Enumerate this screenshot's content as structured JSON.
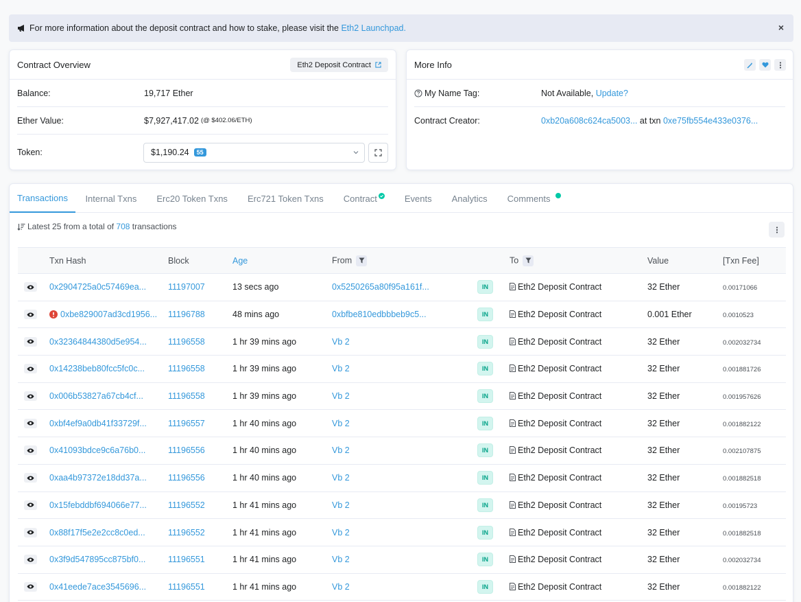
{
  "alert": {
    "text": "For more information about the deposit contract and how to stake, please visit the",
    "link": "Eth2 Launchpad.",
    "close": "×"
  },
  "overview": {
    "title": "Contract Overview",
    "chip": "Eth2 Deposit Contract",
    "balance_label": "Balance:",
    "balance_value": "19,717 Ether",
    "ether_value_label": "Ether Value:",
    "ether_value": "$7,927,417.02",
    "ether_price": "(@ $402.06/ETH)",
    "token_label": "Token:",
    "token_value": "$1,190.24",
    "token_count": "55"
  },
  "more_info": {
    "title": "More Info",
    "name_tag_label": "My Name Tag:",
    "name_tag_value": "Not Available,",
    "name_tag_link": "Update?",
    "creator_label": "Contract Creator:",
    "creator_address": "0xb20a608c624ca5003...",
    "creator_at": "at txn",
    "creator_txn": "0xe75fb554e433e0376..."
  },
  "tabs": [
    {
      "label": "Transactions",
      "active": true
    },
    {
      "label": "Internal Txns"
    },
    {
      "label": "Erc20 Token Txns"
    },
    {
      "label": "Erc721 Token Txns"
    },
    {
      "label": "Contract"
    },
    {
      "label": "Events"
    },
    {
      "label": "Analytics"
    },
    {
      "label": "Comments"
    }
  ],
  "summary": {
    "prefix": "Latest 25 from a total of",
    "count": "708",
    "suffix": "transactions"
  },
  "table": {
    "headers": [
      "Txn Hash",
      "Block",
      "Age",
      "From",
      "To",
      "Value",
      "[Txn Fee]"
    ],
    "rows": [
      {
        "hash": "0x2904725a0c57469ea...",
        "block": "11197007",
        "age": "13 secs ago",
        "from": "0x5250265a80f95a161f...",
        "dir": "IN",
        "to": "Eth2 Deposit Contract",
        "value": "32 Ether",
        "fee": "0.00171066",
        "error": false
      },
      {
        "hash": "0xbe829007ad3cd1956...",
        "block": "11196788",
        "age": "48 mins ago",
        "from": "0xbfbe810edbbbeb9c5...",
        "dir": "IN",
        "to": "Eth2 Deposit Contract",
        "value": "0.001 Ether",
        "fee": "0.0010523",
        "error": true
      },
      {
        "hash": "0x32364844380d5e954...",
        "block": "11196558",
        "age": "1 hr 39 mins ago",
        "from": "Vb 2",
        "dir": "IN",
        "to": "Eth2 Deposit Contract",
        "value": "32 Ether",
        "fee": "0.002032734",
        "error": false
      },
      {
        "hash": "0x14238beb80fcc5fc0c...",
        "block": "11196558",
        "age": "1 hr 39 mins ago",
        "from": "Vb 2",
        "dir": "IN",
        "to": "Eth2 Deposit Contract",
        "value": "32 Ether",
        "fee": "0.001881726",
        "error": false
      },
      {
        "hash": "0x006b53827a67cb4cf...",
        "block": "11196558",
        "age": "1 hr 39 mins ago",
        "from": "Vb 2",
        "dir": "IN",
        "to": "Eth2 Deposit Contract",
        "value": "32 Ether",
        "fee": "0.001957626",
        "error": false
      },
      {
        "hash": "0xbf4ef9a0db41f33729f...",
        "block": "11196557",
        "age": "1 hr 40 mins ago",
        "from": "Vb 2",
        "dir": "IN",
        "to": "Eth2 Deposit Contract",
        "value": "32 Ether",
        "fee": "0.001882122",
        "error": false
      },
      {
        "hash": "0x41093bdce9c6a76b0...",
        "block": "11196556",
        "age": "1 hr 40 mins ago",
        "from": "Vb 2",
        "dir": "IN",
        "to": "Eth2 Deposit Contract",
        "value": "32 Ether",
        "fee": "0.002107875",
        "error": false
      },
      {
        "hash": "0xaa4b97372e18dd37a...",
        "block": "11196556",
        "age": "1 hr 40 mins ago",
        "from": "Vb 2",
        "dir": "IN",
        "to": "Eth2 Deposit Contract",
        "value": "32 Ether",
        "fee": "0.001882518",
        "error": false
      },
      {
        "hash": "0x15febddbf694066e77...",
        "block": "11196552",
        "age": "1 hr 41 mins ago",
        "from": "Vb 2",
        "dir": "IN",
        "to": "Eth2 Deposit Contract",
        "value": "32 Ether",
        "fee": "0.00195723",
        "error": false
      },
      {
        "hash": "0x88f17f5e2e2cc8c0ed...",
        "block": "11196552",
        "age": "1 hr 41 mins ago",
        "from": "Vb 2",
        "dir": "IN",
        "to": "Eth2 Deposit Contract",
        "value": "32 Ether",
        "fee": "0.001882518",
        "error": false
      },
      {
        "hash": "0x3f9d547895cc875bf0...",
        "block": "11196551",
        "age": "1 hr 41 mins ago",
        "from": "Vb 2",
        "dir": "IN",
        "to": "Eth2 Deposit Contract",
        "value": "32 Ether",
        "fee": "0.002032734",
        "error": false
      },
      {
        "hash": "0x41eede7ace3545696...",
        "block": "11196551",
        "age": "1 hr 41 mins ago",
        "from": "Vb 2",
        "dir": "IN",
        "to": "Eth2 Deposit Contract",
        "value": "32 Ether",
        "fee": "0.001882122",
        "error": false
      }
    ]
  },
  "colors": {
    "accent": "#3498db",
    "success": "#00c9a7",
    "error": "#de4437"
  }
}
